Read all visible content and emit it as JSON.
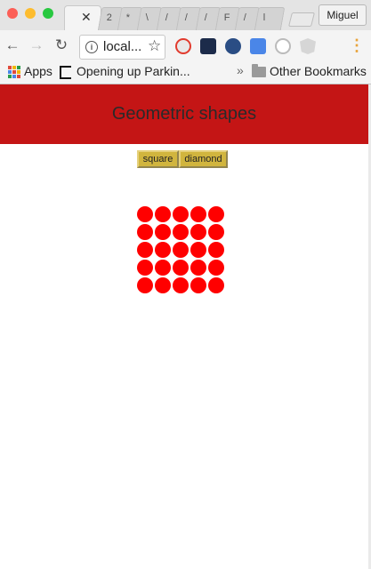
{
  "browser": {
    "profile_name": "Miguel",
    "url": "local...",
    "bookmarks": {
      "apps_label": "Apps",
      "item_1": "Opening up Parkin...",
      "overflow": "»",
      "other": "Other Bookmarks"
    },
    "tabs": [
      {
        "label": "2"
      },
      {
        "label": "*"
      },
      {
        "label": "\\"
      },
      {
        "label": "/"
      },
      {
        "label": "/"
      },
      {
        "label": "/"
      },
      {
        "label": "F"
      },
      {
        "label": "/"
      },
      {
        "label": "l"
      }
    ]
  },
  "page": {
    "title": "Geometric shapes",
    "buttons": {
      "square": "square",
      "diamond": "diamond"
    },
    "grid": {
      "rows": 5,
      "cols": 5,
      "shape": "circle",
      "color": "#ff0000"
    },
    "header_color": "#c41515",
    "button_color": "#d1b53e"
  }
}
